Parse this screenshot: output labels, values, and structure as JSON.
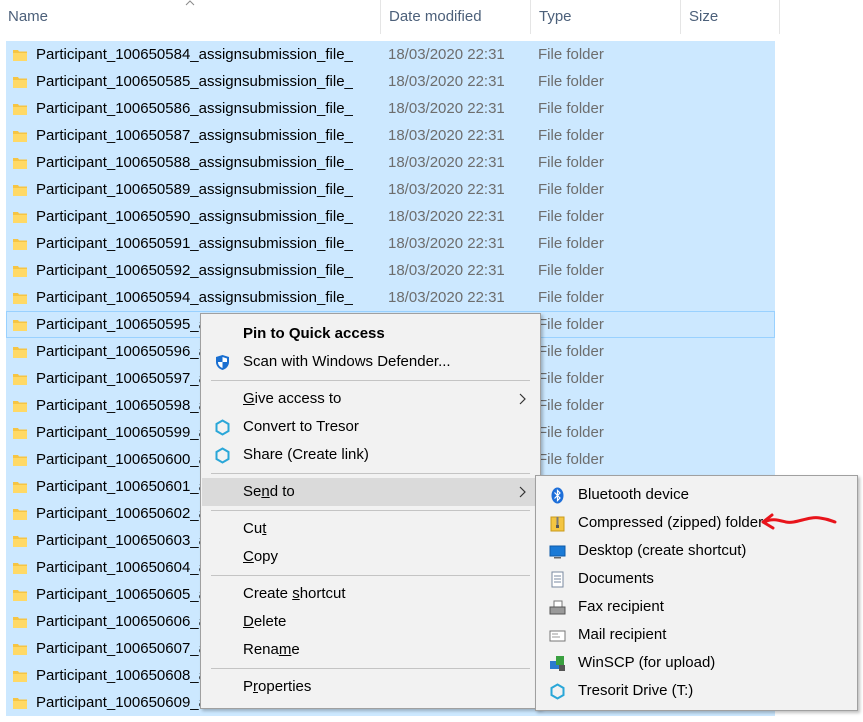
{
  "header": {
    "name": "Name",
    "date_modified": "Date modified",
    "type": "Type",
    "size": "Size"
  },
  "rows": [
    {
      "name": "Participant_100650584_assignsubmission_file_",
      "date": "18/03/2020 22:31",
      "type": "File folder"
    },
    {
      "name": "Participant_100650585_assignsubmission_file_",
      "date": "18/03/2020 22:31",
      "type": "File folder"
    },
    {
      "name": "Participant_100650586_assignsubmission_file_",
      "date": "18/03/2020 22:31",
      "type": "File folder"
    },
    {
      "name": "Participant_100650587_assignsubmission_file_",
      "date": "18/03/2020 22:31",
      "type": "File folder"
    },
    {
      "name": "Participant_100650588_assignsubmission_file_",
      "date": "18/03/2020 22:31",
      "type": "File folder"
    },
    {
      "name": "Participant_100650589_assignsubmission_file_",
      "date": "18/03/2020 22:31",
      "type": "File folder"
    },
    {
      "name": "Participant_100650590_assignsubmission_file_",
      "date": "18/03/2020 22:31",
      "type": "File folder"
    },
    {
      "name": "Participant_100650591_assignsubmission_file_",
      "date": "18/03/2020 22:31",
      "type": "File folder"
    },
    {
      "name": "Participant_100650592_assignsubmission_file_",
      "date": "18/03/2020 22:31",
      "type": "File folder"
    },
    {
      "name": "Participant_100650594_assignsubmission_file_",
      "date": "18/03/2020 22:31",
      "type": "File folder"
    },
    {
      "name": "Participant_100650595_a",
      "date": "",
      "type": "File folder"
    },
    {
      "name": "Participant_100650596_a",
      "date": "",
      "type": "File folder"
    },
    {
      "name": "Participant_100650597_a",
      "date": "",
      "type": "File folder"
    },
    {
      "name": "Participant_100650598_a",
      "date": "",
      "type": "File folder"
    },
    {
      "name": "Participant_100650599_a",
      "date": "",
      "type": "File folder"
    },
    {
      "name": "Participant_100650600_a",
      "date": "",
      "type": "File folder"
    },
    {
      "name": "Participant_100650601_a",
      "date": "",
      "type": ""
    },
    {
      "name": "Participant_100650602_a",
      "date": "",
      "type": ""
    },
    {
      "name": "Participant_100650603_a",
      "date": "",
      "type": ""
    },
    {
      "name": "Participant_100650604_a",
      "date": "",
      "type": ""
    },
    {
      "name": "Participant_100650605_a",
      "date": "",
      "type": ""
    },
    {
      "name": "Participant_100650606_a",
      "date": "",
      "type": ""
    },
    {
      "name": "Participant_100650607_a",
      "date": "",
      "type": ""
    },
    {
      "name": "Participant_100650608_a",
      "date": "",
      "type": ""
    },
    {
      "name": "Participant_100650609_a",
      "date": "",
      "type": ""
    }
  ],
  "context_menu": {
    "pin": "Pin to Quick access",
    "scan": "Scan with Windows Defender...",
    "give_access": {
      "pre": "",
      "u": "G",
      "post": "ive access to"
    },
    "tresor": "Convert to Tresor",
    "share": "Share (Create link)",
    "send_to": {
      "pre": "Se",
      "u": "n",
      "post": "d to"
    },
    "cut": {
      "pre": "Cu",
      "u": "t",
      "post": ""
    },
    "copy": {
      "pre": "",
      "u": "C",
      "post": "opy"
    },
    "create_shortcut": {
      "pre": "Create ",
      "u": "s",
      "post": "hortcut"
    },
    "delete": {
      "pre": "",
      "u": "D",
      "post": "elete"
    },
    "rename": {
      "pre": "Rena",
      "u": "m",
      "post": "e"
    },
    "properties": {
      "pre": "P",
      "u": "r",
      "post": "operties"
    }
  },
  "send_to_menu": {
    "bluetooth": "Bluetooth device",
    "zip": "Compressed (zipped) folder",
    "desktop": "Desktop (create shortcut)",
    "documents": "Documents",
    "fax": "Fax recipient",
    "mail": "Mail recipient",
    "winscp": "WinSCP (for upload)",
    "tresorit": "Tresorit Drive (T:)"
  },
  "colors": {
    "selection": "#cce8ff",
    "menu_bg": "#f2f2f2",
    "annotation_arrow": "#e8141b"
  }
}
